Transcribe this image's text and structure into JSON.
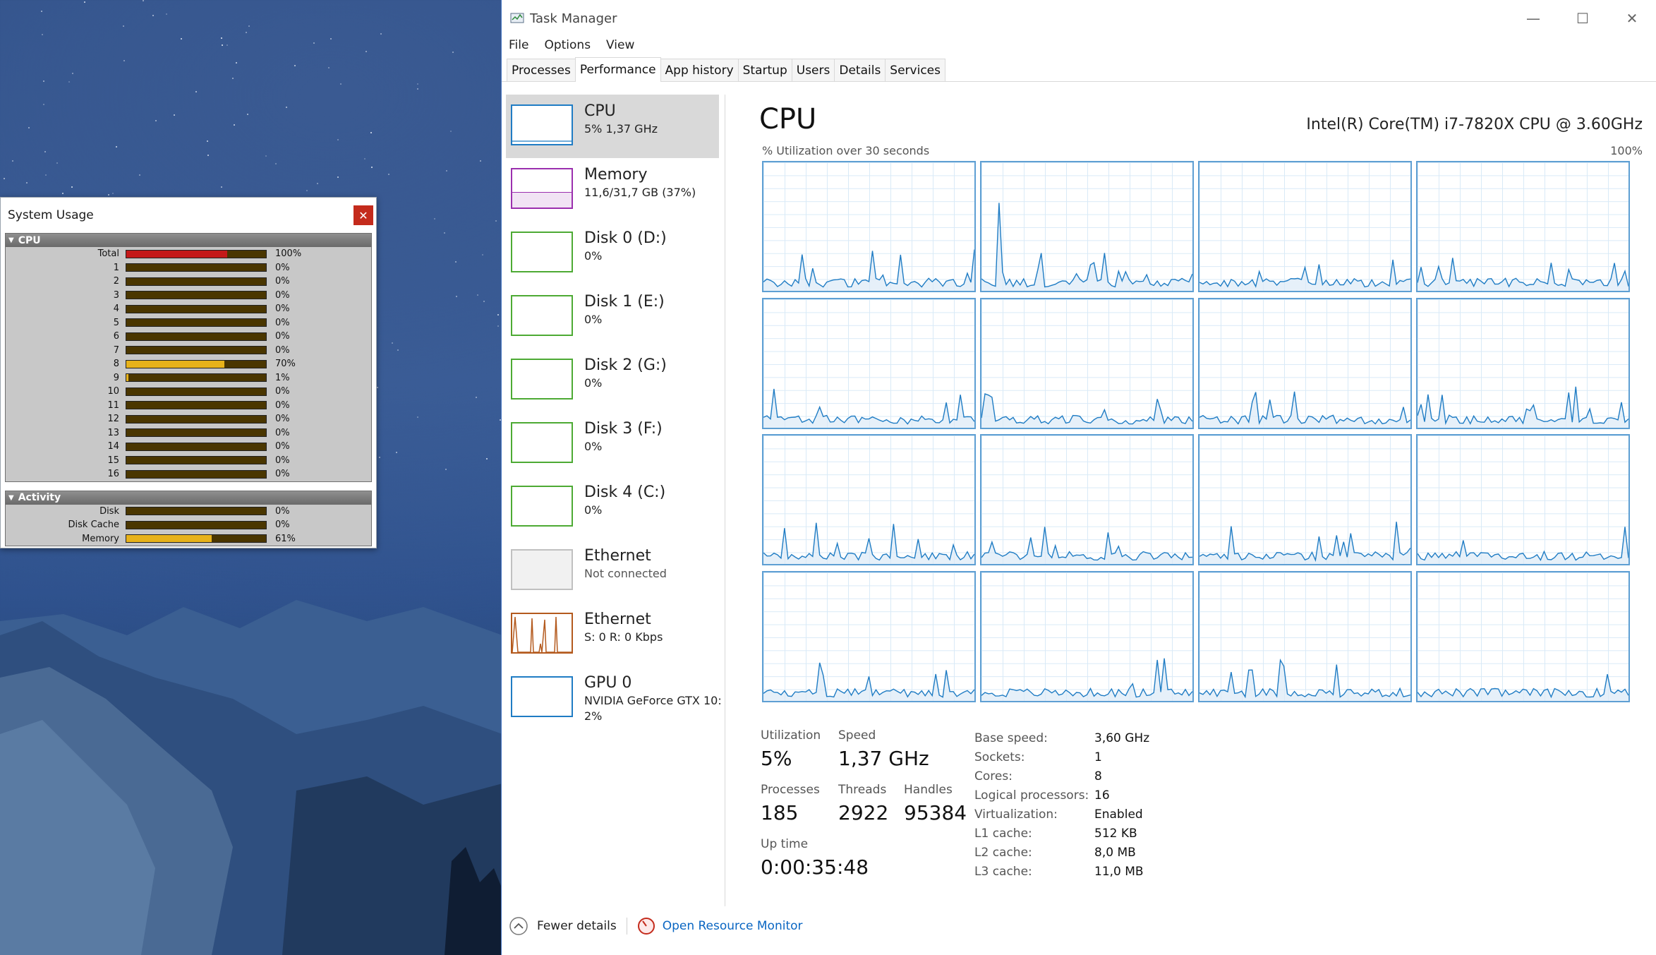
{
  "system_usage": {
    "title": "System Usage",
    "close_icon": "close-icon",
    "cpu_header": "CPU",
    "rows": [
      {
        "label": "Total",
        "value": 1.0,
        "text": "100%",
        "color": "#c41919"
      },
      {
        "label": "1",
        "value": 0.0,
        "text": "0%"
      },
      {
        "label": "2",
        "value": 0.0,
        "text": "0%"
      },
      {
        "label": "3",
        "value": 0.0,
        "text": "0%"
      },
      {
        "label": "4",
        "value": 0.0,
        "text": "0%"
      },
      {
        "label": "5",
        "value": 0.0,
        "text": "0%"
      },
      {
        "label": "6",
        "value": 0.0,
        "text": "0%"
      },
      {
        "label": "7",
        "value": 0.0,
        "text": "0%"
      },
      {
        "label": "8",
        "value": 0.7,
        "text": "70%"
      },
      {
        "label": "9",
        "value": 0.01,
        "text": "1%"
      },
      {
        "label": "10",
        "value": 0.0,
        "text": "0%"
      },
      {
        "label": "11",
        "value": 0.0,
        "text": "0%"
      },
      {
        "label": "12",
        "value": 0.0,
        "text": "0%"
      },
      {
        "label": "13",
        "value": 0.0,
        "text": "0%"
      },
      {
        "label": "14",
        "value": 0.0,
        "text": "0%"
      },
      {
        "label": "15",
        "value": 0.0,
        "text": "0%"
      },
      {
        "label": "16",
        "value": 0.0,
        "text": "0%"
      }
    ],
    "activity_header": "Activity",
    "activity_rows": [
      {
        "label": "Disk",
        "value": 0.0,
        "text": "0%"
      },
      {
        "label": "Disk Cache",
        "value": 0.0,
        "text": "0%"
      },
      {
        "label": "Memory",
        "value": 0.61,
        "text": "61%"
      }
    ]
  },
  "task_manager": {
    "title": "Task Manager",
    "menu": [
      "File",
      "Options",
      "View"
    ],
    "tabs": [
      "Processes",
      "Performance",
      "App history",
      "Startup",
      "Users",
      "Details",
      "Services"
    ],
    "active_tab": "Performance",
    "resources": [
      {
        "name": "CPU",
        "sub": "5% 1,37 GHz",
        "color": "#1f7cc4"
      },
      {
        "name": "Memory",
        "sub": "11,6/31,7 GB (37%)",
        "color": "#9b2fae"
      },
      {
        "name": "Disk 0 (D:)",
        "sub": "0%",
        "color": "#4daa34"
      },
      {
        "name": "Disk 1 (E:)",
        "sub": "0%",
        "color": "#4daa34"
      },
      {
        "name": "Disk 2 (G:)",
        "sub": "0%",
        "color": "#4daa34"
      },
      {
        "name": "Disk 3 (F:)",
        "sub": "0%",
        "color": "#4daa34"
      },
      {
        "name": "Disk 4 (C:)",
        "sub": "0%",
        "color": "#4daa34"
      },
      {
        "name": "Ethernet",
        "sub": "Not connected",
        "color": "#c0c0c0"
      },
      {
        "name": "Ethernet",
        "sub": "S: 0 R: 0 Kbps",
        "color": "#b45a1e"
      },
      {
        "name": "GPU 0",
        "sub": "NVIDIA GeForce GTX 10:",
        "sub2": "2%",
        "color": "#1f7cc4"
      }
    ],
    "cpu": {
      "heading": "CPU",
      "model": "Intel(R) Core(TM) i7-7820X CPU @ 3.60GHz",
      "util_label": "% Utilization over 30 seconds",
      "util_max": "100%",
      "stats": {
        "utilization_label": "Utilization",
        "utilization": "5%",
        "speed_label": "Speed",
        "speed": "1,37 GHz",
        "processes_label": "Processes",
        "processes": "185",
        "threads_label": "Threads",
        "threads": "2922",
        "handles_label": "Handles",
        "handles": "95384",
        "uptime_label": "Up time",
        "uptime": "0:00:35:48"
      },
      "specs": [
        {
          "k": "Base speed:",
          "v": "3,60 GHz"
        },
        {
          "k": "Sockets:",
          "v": "1"
        },
        {
          "k": "Cores:",
          "v": "8"
        },
        {
          "k": "Logical processors:",
          "v": "16"
        },
        {
          "k": "Virtualization:",
          "v": "Enabled"
        },
        {
          "k": "L1 cache:",
          "v": "512 KB"
        },
        {
          "k": "L2 cache:",
          "v": "8,0 MB"
        },
        {
          "k": "L3 cache:",
          "v": "11,0 MB"
        }
      ]
    },
    "footer": {
      "fewer_details": "Fewer details",
      "open_resource_monitor": "Open Resource Monitor"
    },
    "colors": {
      "accent": "#1f7cc4",
      "graph_line": "#1f7cc4",
      "graph_border": "#5e9fd3"
    }
  }
}
